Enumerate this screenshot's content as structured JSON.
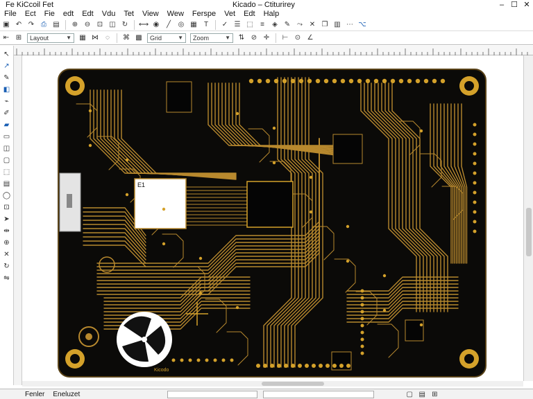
{
  "window": {
    "app_title": "Fe KiCcoil Fet",
    "title": "Kicado – Ctiturirey",
    "controls": [
      "–",
      "☐",
      "✕"
    ]
  },
  "menubar": {
    "items": [
      "File",
      "Ect",
      "Fie",
      "edt",
      "Edt",
      "Vdu",
      "Tet",
      "View",
      "Wew",
      "Ferspe",
      "Vet",
      "Edt",
      "Halp"
    ]
  },
  "toolbar1": {
    "icons": [
      "save-icon",
      "undo-icon",
      "redo-icon",
      "print-icon",
      "plot-icon",
      "zoom-in-icon",
      "zoom-out-icon",
      "zoom-fit-icon",
      "zoom-area-icon",
      "refresh-icon",
      "measure-icon",
      "pad-icon",
      "track-icon",
      "via-icon",
      "zone-icon",
      "text-icon",
      "drc-icon",
      "netlist-icon",
      "footprint-icon",
      "layer-icon",
      "3d-icon"
    ]
  },
  "toolbar2": {
    "layer_select": "Layout",
    "grid_select": "Grid",
    "zoom_select": "Zoom"
  },
  "pcb": {
    "board_color": "#0b0a08",
    "copper_color": "#b8892e",
    "pad_color": "#d4a12a",
    "chip_label": "E1",
    "silk_label": "Kicodo"
  },
  "statusbar": {
    "label": "Fenler",
    "field_value": "Eneluzet"
  }
}
